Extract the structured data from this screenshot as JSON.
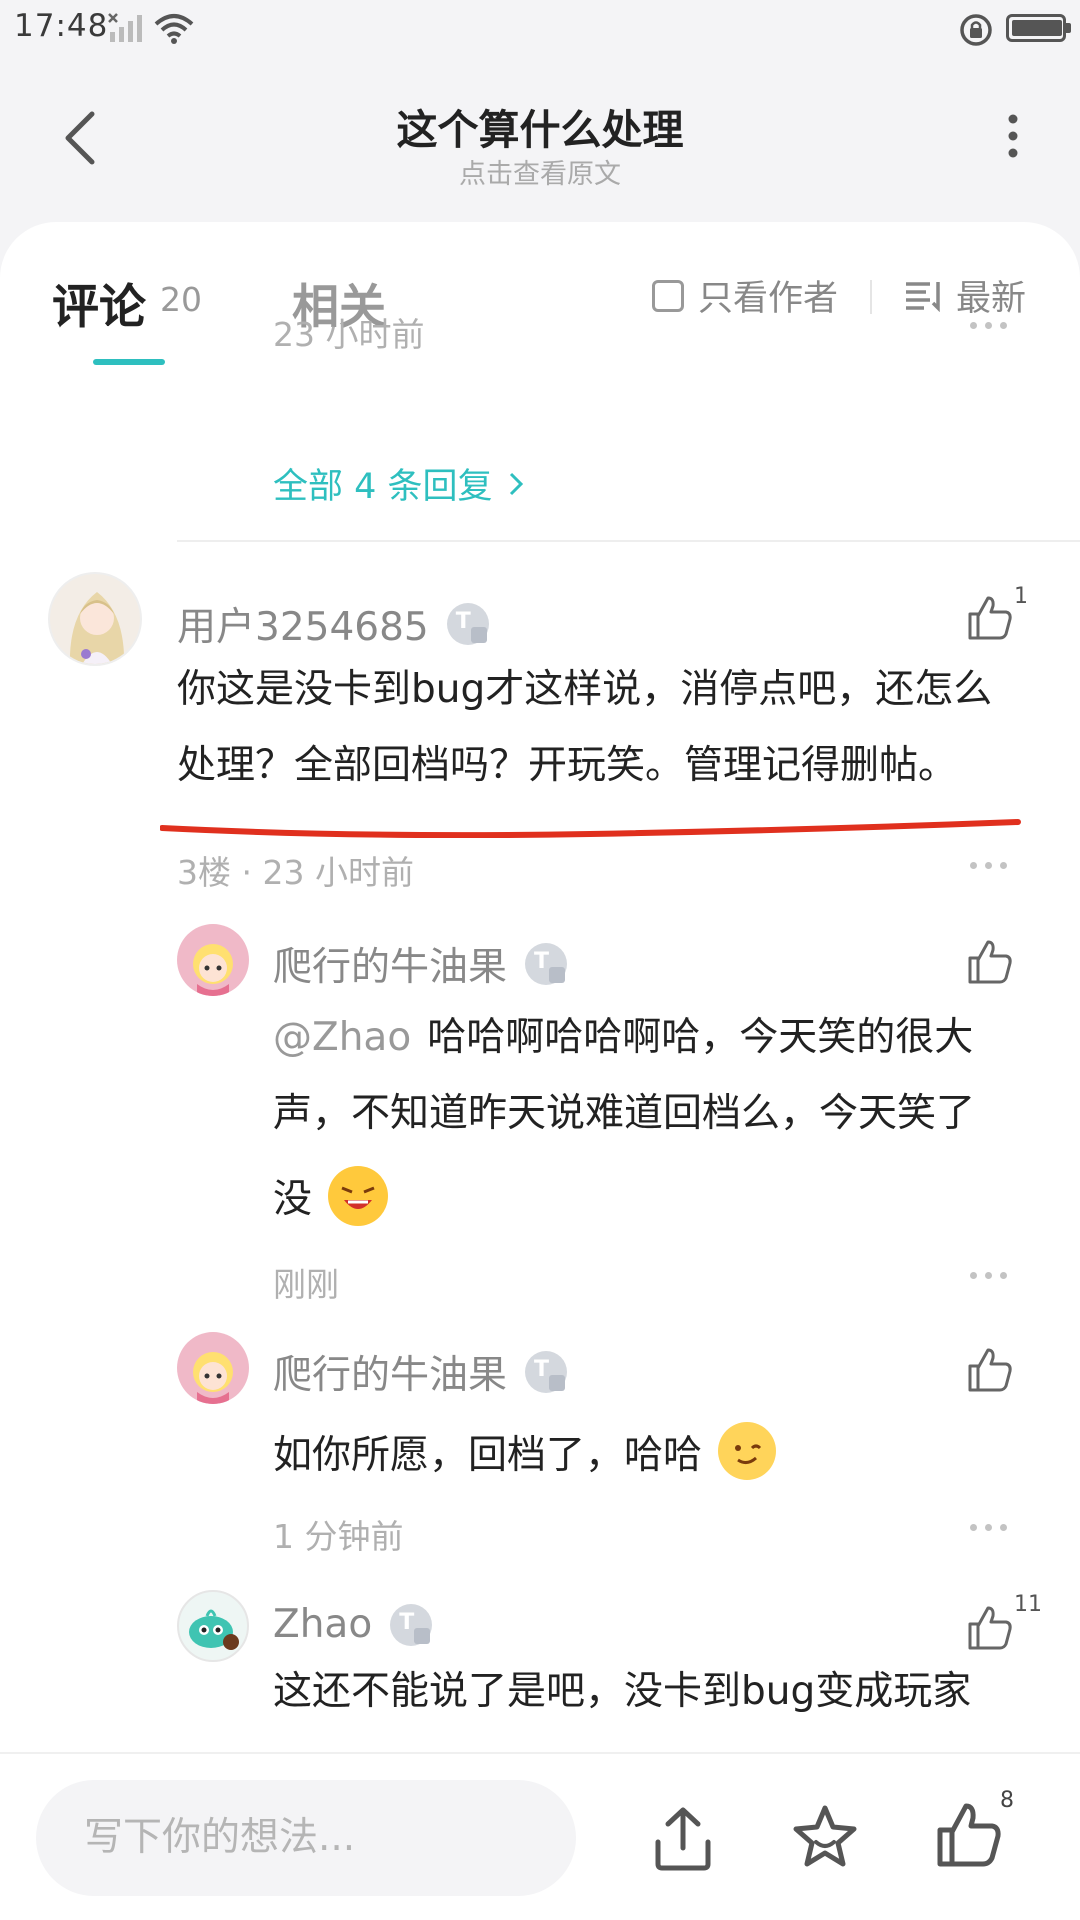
{
  "status": {
    "time": "17:48"
  },
  "header": {
    "title": "这个算什么处理",
    "subtitle": "点击查看原文"
  },
  "tabs": {
    "comments_label": "评论",
    "comments_count": "20",
    "related_label": "相关",
    "only_author_label": "只看作者",
    "sort_label": "最新",
    "accent": "#2ebfbf"
  },
  "prev": {
    "time": "23 小时前",
    "all_replies": "全部 4 条回复"
  },
  "comment": {
    "username": "用户3254685",
    "like_count": "1",
    "text_line1": "你这是没卡到bug才这样说，消停点吧，还怎么",
    "text_line2": "处理？全部回档吗？开玩笑。管理记得删帖。",
    "meta": "3楼 · 23 小时前"
  },
  "replies": [
    {
      "username": "爬行的牛油果",
      "mention": "@Zhao",
      "line1": "哈哈啊哈哈啊哈，今天笑的很大",
      "line2": "声，不知道昨天说难道回档么，今天笑了",
      "line3": "没",
      "time": "刚刚"
    },
    {
      "username": "爬行的牛油果",
      "line1": "如你所愿，回档了，哈哈",
      "time": "1 分钟前"
    },
    {
      "username": "Zhao",
      "like_count": "11",
      "line1": "这还不能说了是吧，没卡到bug变成玩家"
    }
  ],
  "bottom": {
    "placeholder": "写下你的想法...",
    "like_count": "8"
  }
}
